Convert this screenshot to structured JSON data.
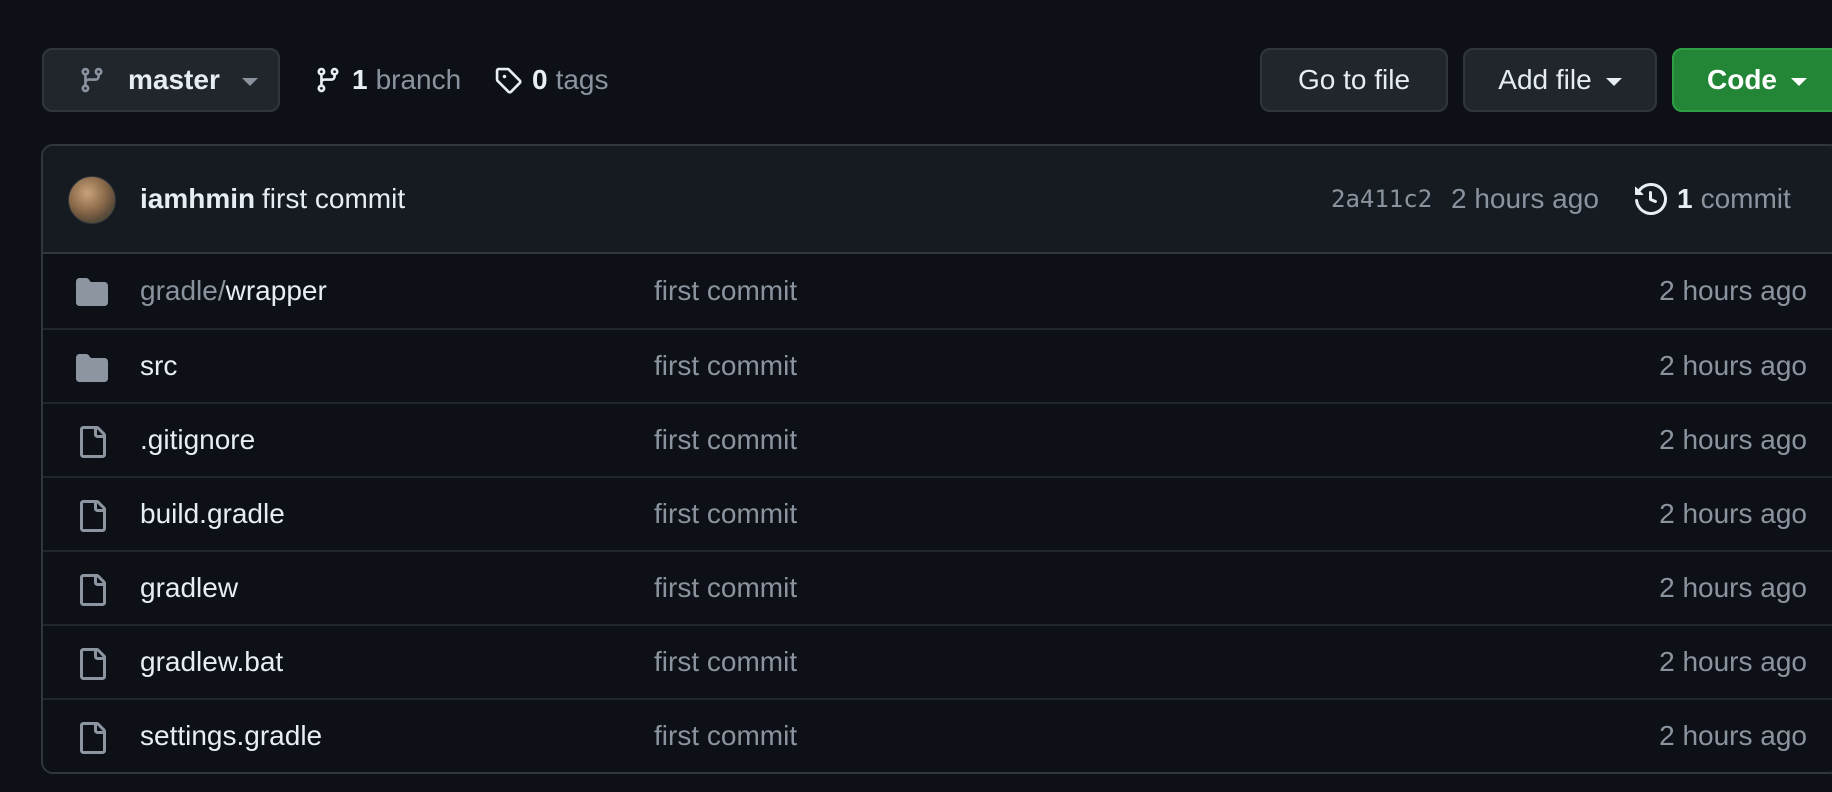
{
  "toolbar": {
    "branch_name": "master",
    "branch_count": "1",
    "branch_word": "branch",
    "tag_count": "0",
    "tag_word": "tags",
    "go_to_file": "Go to file",
    "add_file": "Add file",
    "code": "Code"
  },
  "latest_commit": {
    "author": "iamhmin",
    "message": "first commit",
    "sha": "2a411c2",
    "time": "2 hours ago",
    "commit_count": "1",
    "commit_word": "commit"
  },
  "files": [
    {
      "type": "folder",
      "name_prefix": "gradle/",
      "name": "wrapper",
      "message": "first commit",
      "time": "2 hours ago"
    },
    {
      "type": "folder",
      "name_prefix": "",
      "name": "src",
      "message": "first commit",
      "time": "2 hours ago"
    },
    {
      "type": "file",
      "name_prefix": "",
      "name": ".gitignore",
      "message": "first commit",
      "time": "2 hours ago"
    },
    {
      "type": "file",
      "name_prefix": "",
      "name": "build.gradle",
      "message": "first commit",
      "time": "2 hours ago"
    },
    {
      "type": "file",
      "name_prefix": "",
      "name": "gradlew",
      "message": "first commit",
      "time": "2 hours ago"
    },
    {
      "type": "file",
      "name_prefix": "",
      "name": "gradlew.bat",
      "message": "first commit",
      "time": "2 hours ago"
    },
    {
      "type": "file",
      "name_prefix": "",
      "name": "settings.gradle",
      "message": "first commit",
      "time": "2 hours ago"
    }
  ],
  "colors": {
    "background": "#0d1117",
    "accent_green": "#238636",
    "muted_text": "#8b949e",
    "folder_icon": "#8d96a0"
  }
}
